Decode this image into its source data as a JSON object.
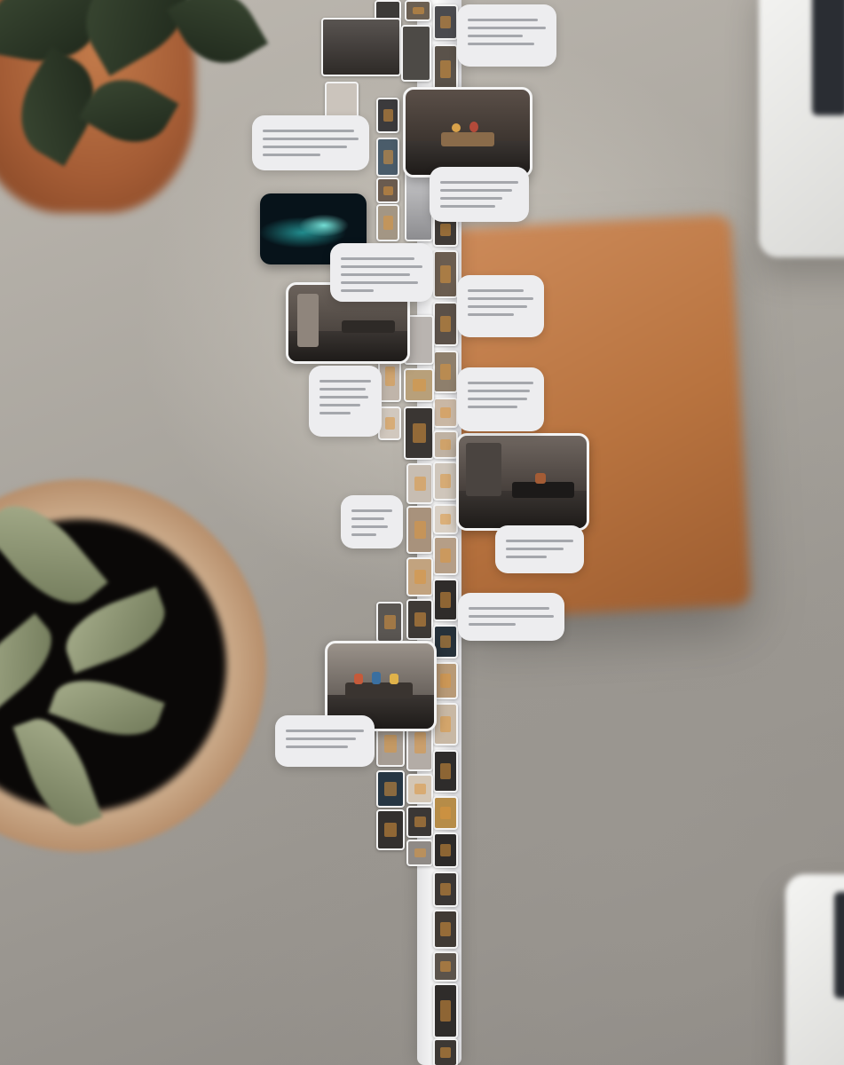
{
  "scene": {
    "background_color": "#a6a29b",
    "accent_colors": [
      "#b8733f",
      "#a45c35",
      "#1d261a",
      "#ededef"
    ]
  },
  "icons": {
    "plant_top": "potted-plant-icon",
    "plant_bottom": "potted-plant-icon",
    "notebook": "notebook-icon",
    "device": "laptop-icon"
  }
}
